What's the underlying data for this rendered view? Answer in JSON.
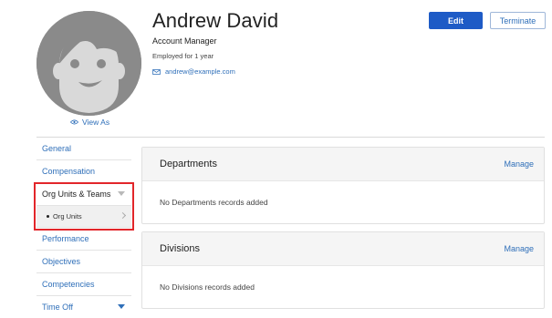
{
  "profile": {
    "name": "Andrew David",
    "job_title": "Account Manager",
    "tenure": "Employed for 1 year",
    "email": "andrew@example.com",
    "view_as": "View As"
  },
  "actions": {
    "edit": "Edit",
    "terminate": "Terminate"
  },
  "sidebar": {
    "items": [
      {
        "label": "General"
      },
      {
        "label": "Compensation"
      },
      {
        "label": "Org Units & Teams",
        "expanded": true
      },
      {
        "label": "Performance"
      },
      {
        "label": "Objectives"
      },
      {
        "label": "Competencies"
      },
      {
        "label": "Time Off"
      }
    ],
    "sub_items": [
      {
        "label": "Org Units"
      }
    ]
  },
  "panels": [
    {
      "title": "Departments",
      "manage": "Manage",
      "empty": "No Departments records added"
    },
    {
      "title": "Divisions",
      "manage": "Manage",
      "empty": "No Divisions records added"
    }
  ],
  "colors": {
    "accent": "#1e5bc6",
    "link": "#2f6fb9",
    "highlight": "#e2262a",
    "avatar_bg": "#8a8a8a"
  },
  "icons": [
    "avatar-placeholder",
    "eye-icon",
    "envelope-icon",
    "caret-down-icon",
    "chevron-right-icon"
  ]
}
